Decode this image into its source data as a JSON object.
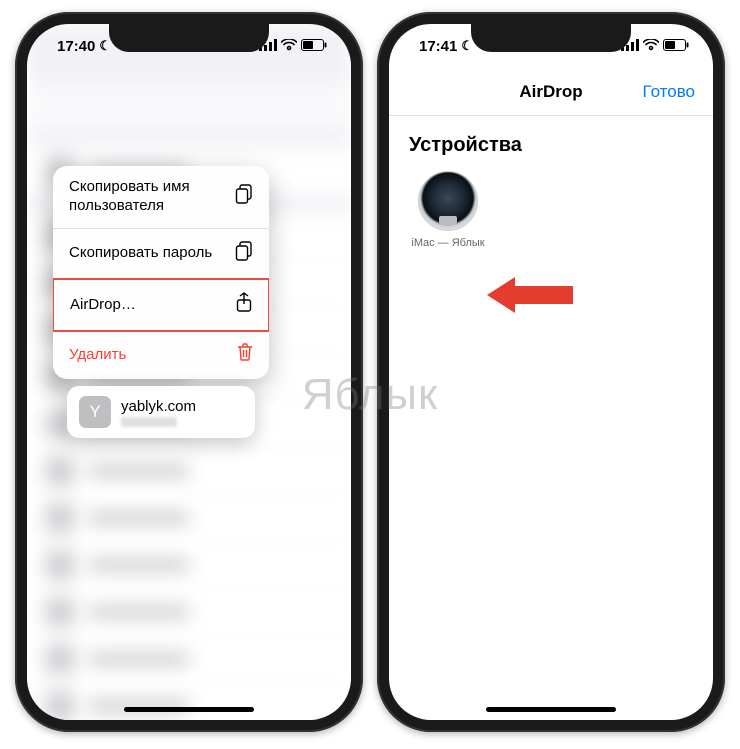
{
  "watermark": "Яблык",
  "left": {
    "status": {
      "time": "17:40"
    },
    "menu": {
      "copy_username": "Скопировать имя пользователя",
      "copy_password": "Скопировать пароль",
      "airdrop": "AirDrop…",
      "delete": "Удалить"
    },
    "preview": {
      "avatar_letter": "Y",
      "title": "yablyk.com"
    }
  },
  "right": {
    "status": {
      "time": "17:41"
    },
    "nav": {
      "title": "AirDrop",
      "done": "Готово"
    },
    "section_header": "Устройства",
    "device": {
      "label": "iMac — Яблык"
    }
  }
}
